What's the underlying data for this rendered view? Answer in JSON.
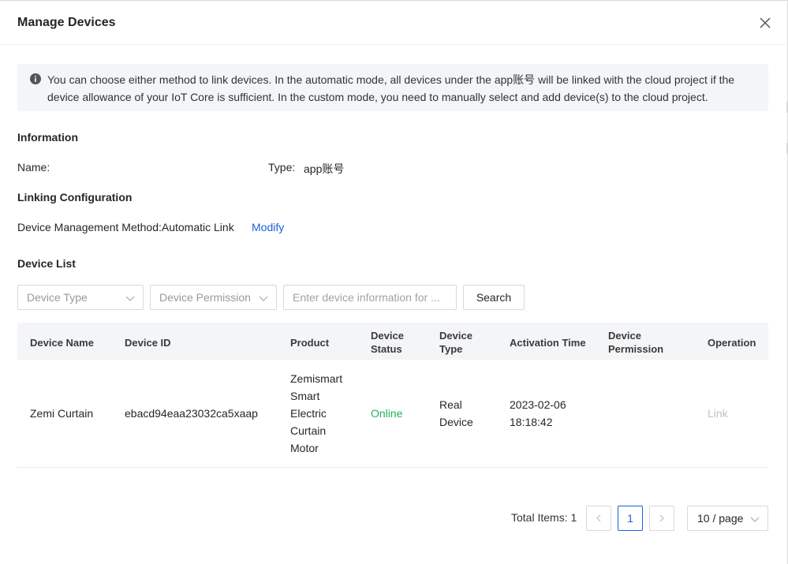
{
  "dialog": {
    "title": "Manage Devices"
  },
  "alert": {
    "text": "You can choose either method to link devices. In the automatic mode, all devices under the app账号 will be linked with the cloud project if the device allowance of your IoT Core is sufficient. In the custom mode, you need to manually select and add device(s) to the cloud project."
  },
  "information": {
    "section_title": "Information",
    "name_label": "Name:",
    "name_value": "",
    "type_label": "Type:",
    "type_value": "app账号"
  },
  "linking": {
    "section_title": "Linking Configuration",
    "method_label": "Device Management Method:",
    "method_value": "Automatic Link",
    "modify_label": "Modify"
  },
  "device_list": {
    "section_title": "Device List",
    "filters": {
      "device_type_placeholder": "Device Type",
      "device_permission_placeholder": "Device Permission",
      "search_placeholder": "Enter device information for ...",
      "search_button": "Search"
    },
    "columns": {
      "device_name": "Device Name",
      "device_id": "Device ID",
      "product": "Product",
      "device_status_1": "Device",
      "device_status_2": "Status",
      "device_type_1": "Device",
      "device_type_2": "Type",
      "activation_time": "Activation Time",
      "device_permission_1": "Device",
      "device_permission_2": "Permission",
      "operation": "Operation"
    },
    "rows": [
      {
        "device_name": "Zemi Curtain",
        "device_id": "ebacd94eaa23032ca5xaap",
        "product_lines": [
          "Zemismart",
          "Smart",
          "Electric",
          "Curtain",
          "Motor"
        ],
        "status": "Online",
        "type_lines": [
          "Real",
          "Device"
        ],
        "activation_lines": [
          "2023-02-06",
          "18:18:42"
        ],
        "permission": "",
        "operation": "Link"
      }
    ]
  },
  "pagination": {
    "total_label": "Total Items: 1",
    "current_page": "1",
    "page_size": "10 / page"
  },
  "colors": {
    "accent": "#1b5fdc",
    "online": "#20b15a",
    "disabled": "#bfbfbf"
  }
}
